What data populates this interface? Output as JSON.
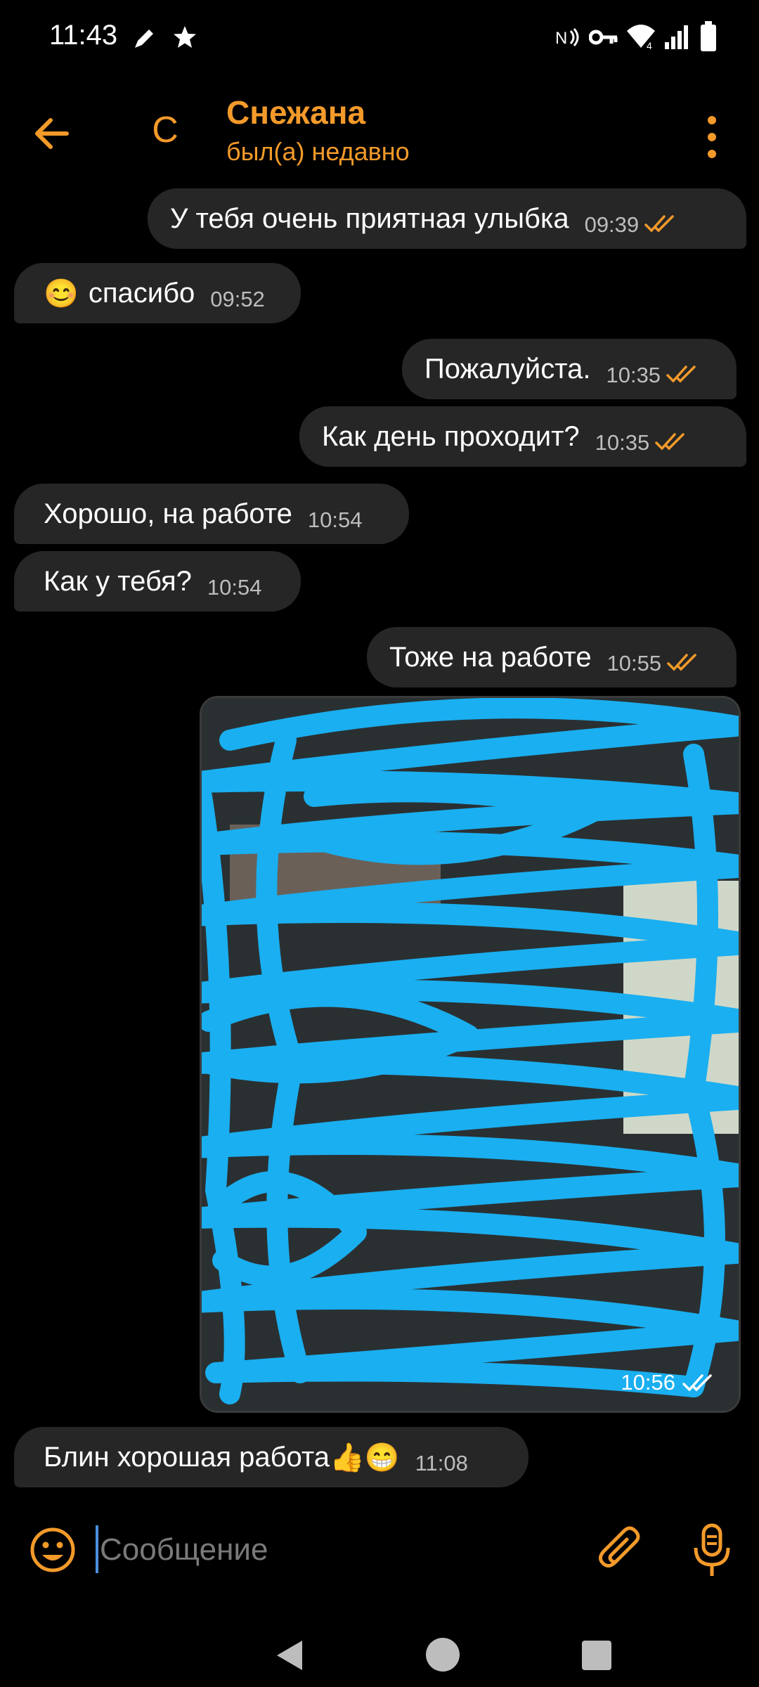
{
  "status_bar": {
    "time": "11:43",
    "signal_label": "4"
  },
  "header": {
    "name": "Снежана",
    "status": "был(а) недавно",
    "avatar_letter": "С"
  },
  "messages": [
    {
      "direction": "out",
      "text": "У тебя очень приятная улыбка",
      "time": "09:39",
      "read": true
    },
    {
      "direction": "in",
      "emoji": "😊",
      "text": "спасибо",
      "time": "09:52"
    },
    {
      "direction": "out",
      "text": "Пожалуйста.",
      "time": "10:35",
      "read": true
    },
    {
      "direction": "out",
      "text": "Как день проходит?",
      "time": "10:35",
      "read": true
    },
    {
      "direction": "in",
      "text": "Хорошо, на работе",
      "time": "10:54"
    },
    {
      "direction": "in",
      "text": "Как у тебя?",
      "time": "10:54"
    },
    {
      "direction": "out",
      "text": "Тоже на работе",
      "time": "10:55",
      "read": true
    },
    {
      "direction": "out",
      "type": "photo",
      "time": "10:56",
      "read": true
    },
    {
      "direction": "in",
      "text": "Блин хорошая работа",
      "emoji_trail": "👍😁",
      "time": "11:08"
    }
  ],
  "composer": {
    "placeholder": "Сообщение"
  },
  "colors": {
    "accent": "#f39a2a",
    "bubble": "#262626",
    "background": "#000000",
    "scribble": "#1aaff0"
  }
}
